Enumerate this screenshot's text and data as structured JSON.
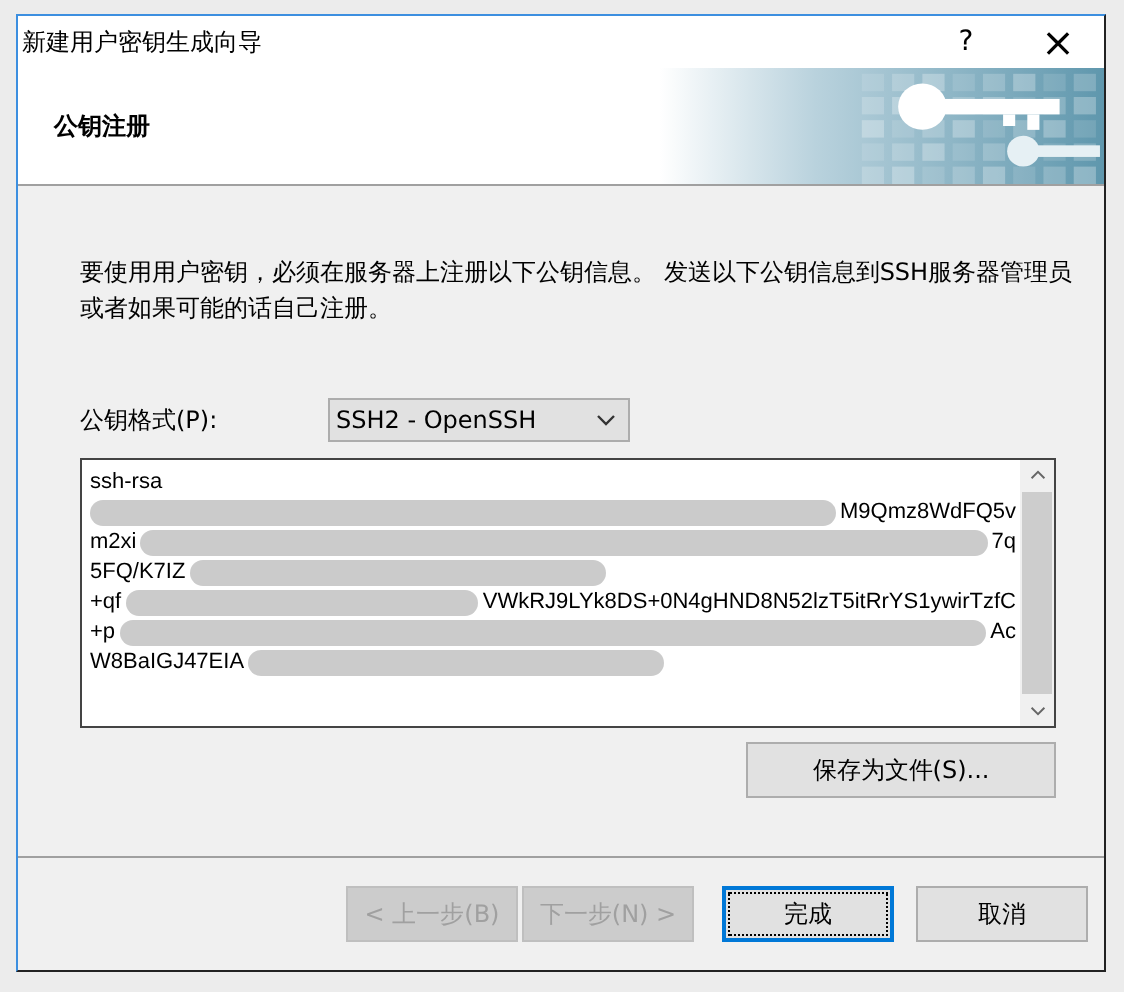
{
  "window": {
    "title": "新建用户密钥生成向导",
    "help": "?",
    "close": "×"
  },
  "header": {
    "title": "公钥注册"
  },
  "description": "要使用用户密钥，必须在服务器上注册以下公钥信息。 发送以下公钥信息到SSH服务器管理员或者如果可能的话自己注册。",
  "format": {
    "label": "公钥格式(P):",
    "value": "SSH2 - OpenSSH"
  },
  "key_lines": [
    {
      "left": "ssh-rsa",
      "redacted": false
    },
    {
      "right": "M9Qmz8WdFQ5v",
      "redacted": true
    },
    {
      "left": "m2xi",
      "right": "7q",
      "redacted": true
    },
    {
      "left": "5FQ/K7IZ",
      "redacted": true
    },
    {
      "left": "+qf",
      "right": "VWkRJ9LYk8DS+0N4gHND8N52lzT5itRrYS1ywirTzfC",
      "redacted": true
    },
    {
      "left": "+p",
      "right": "Ac",
      "redacted": true
    },
    {
      "left": "W8BaIGJ47EIA",
      "redacted": true
    }
  ],
  "save_button": "保存为文件(S)...",
  "buttons": [
    {
      "label": "< 上一步(B)",
      "disabled": true,
      "default": false
    },
    {
      "label": "下一步(N) >",
      "disabled": true,
      "default": false
    },
    {
      "label": "完成",
      "disabled": false,
      "default": true
    },
    {
      "label": "取消",
      "disabled": false,
      "default": false
    }
  ]
}
